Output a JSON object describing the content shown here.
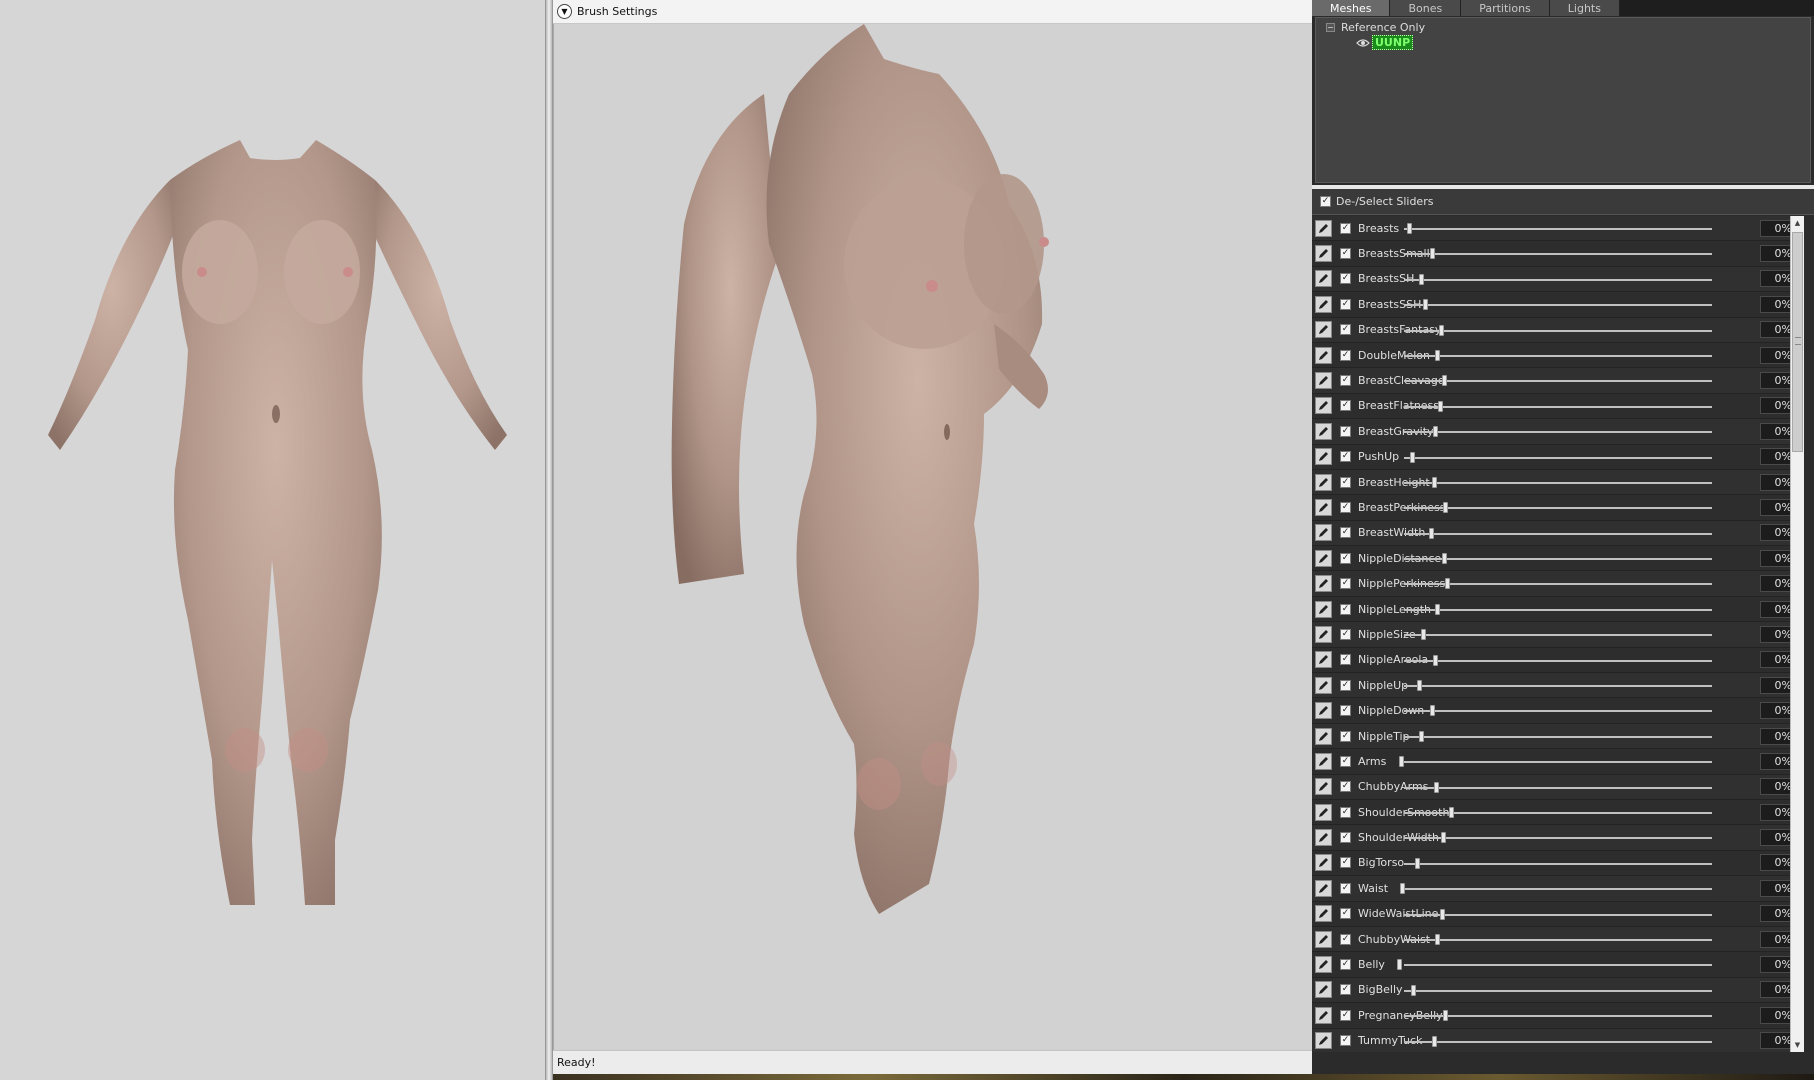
{
  "brush_settings_label": "Brush Settings",
  "status_text": "Ready!",
  "tabs": [
    "Meshes",
    "Bones",
    "Partitions",
    "Lights"
  ],
  "active_tab": "Meshes",
  "tree": {
    "root_label": "Reference Only",
    "expander": "−",
    "mesh_name": "UUNP"
  },
  "slider_header": {
    "label": "De-/Select Sliders",
    "checked": true
  },
  "sliders": [
    {
      "name": "Breasts",
      "value": "0%",
      "checked": true
    },
    {
      "name": "BreastsSmall",
      "value": "0%",
      "checked": true
    },
    {
      "name": "BreastsSH",
      "value": "0%",
      "checked": true
    },
    {
      "name": "BreastsSSH",
      "value": "0%",
      "checked": true
    },
    {
      "name": "BreastsFantasy",
      "value": "0%",
      "checked": true
    },
    {
      "name": "DoubleMelon",
      "value": "0%",
      "checked": true
    },
    {
      "name": "BreastCleavage",
      "value": "0%",
      "checked": true
    },
    {
      "name": "BreastFlatness",
      "value": "0%",
      "checked": true
    },
    {
      "name": "BreastGravity",
      "value": "0%",
      "checked": true
    },
    {
      "name": "PushUp",
      "value": "0%",
      "checked": true
    },
    {
      "name": "BreastHeight",
      "value": "0%",
      "checked": true
    },
    {
      "name": "BreastPerkiness",
      "value": "0%",
      "checked": true
    },
    {
      "name": "BreastWidth",
      "value": "0%",
      "checked": true
    },
    {
      "name": "NippleDistance",
      "value": "0%",
      "checked": true
    },
    {
      "name": "NipplePerkiness",
      "value": "0%",
      "checked": true
    },
    {
      "name": "NippleLength",
      "value": "0%",
      "checked": true
    },
    {
      "name": "NippleSize",
      "value": "0%",
      "checked": true
    },
    {
      "name": "NippleAreola",
      "value": "0%",
      "checked": true
    },
    {
      "name": "NippleUp",
      "value": "0%",
      "checked": true
    },
    {
      "name": "NippleDown",
      "value": "0%",
      "checked": true
    },
    {
      "name": "NippleTip",
      "value": "0%",
      "checked": true
    },
    {
      "name": "Arms",
      "value": "0%",
      "checked": true
    },
    {
      "name": "ChubbyArms",
      "value": "0%",
      "checked": true
    },
    {
      "name": "ShoulderSmooth",
      "value": "0%",
      "checked": true
    },
    {
      "name": "ShoulderWidth",
      "value": "0%",
      "checked": true
    },
    {
      "name": "BigTorso",
      "value": "0%",
      "checked": true
    },
    {
      "name": "Waist",
      "value": "0%",
      "checked": true
    },
    {
      "name": "WideWaistLine",
      "value": "0%",
      "checked": true
    },
    {
      "name": "ChubbyWaist",
      "value": "0%",
      "checked": true
    },
    {
      "name": "Belly",
      "value": "0%",
      "checked": true
    },
    {
      "name": "BigBelly",
      "value": "0%",
      "checked": true
    },
    {
      "name": "PregnancyBelly",
      "value": "0%",
      "checked": true
    },
    {
      "name": "TummyTuck",
      "value": "0%",
      "checked": true
    }
  ],
  "colors": {
    "panel_bg": "#2b2b2b",
    "viewport_bg": "#d2d2d2",
    "mesh_highlight": "#1a8a1a",
    "skin": "#b59a8e"
  },
  "icons": {
    "brush_toggle": "chevron-down-circle-icon",
    "slider_edit": "pencil-icon",
    "tree_visibility": "eye-icon"
  }
}
